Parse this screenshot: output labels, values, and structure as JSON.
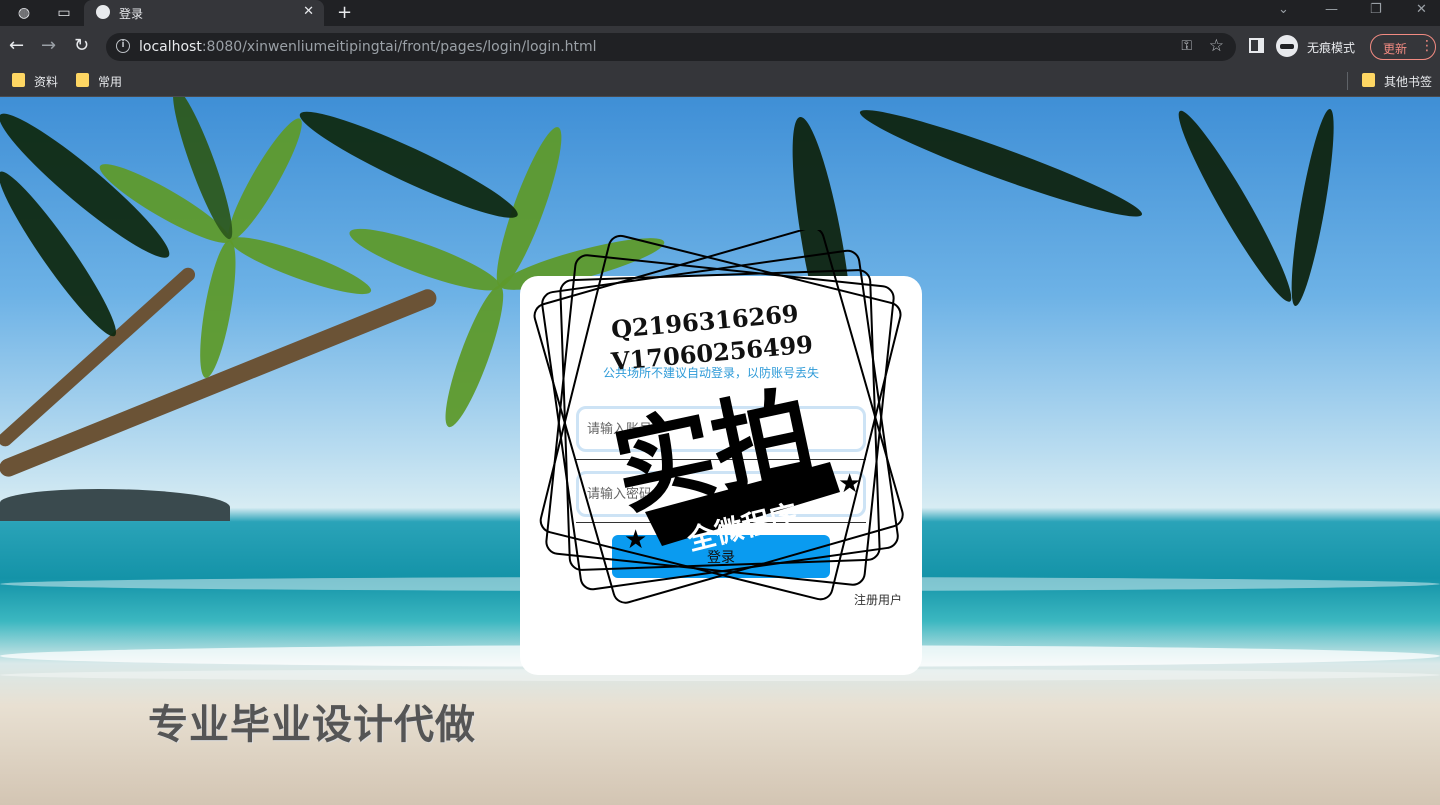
{
  "browser": {
    "tab_title": "登录",
    "url_host": "localhost",
    "url_rest": ":8080/xinwenliumeitipingtai/front/pages/login/login.html",
    "incognito_label": "无痕模式",
    "update_label": "更新",
    "bookmarks": [
      {
        "label": "资料"
      },
      {
        "label": "常用"
      }
    ],
    "other_bookmarks": "其他书签"
  },
  "login": {
    "notice": "公共场所不建议自动登录，以防账号丢失",
    "account_placeholder": "请输入账号",
    "password_placeholder": "请输入密码",
    "login_button": "登录",
    "register_link": "注册用户"
  },
  "overlay": {
    "contact_q": "Q2196316269",
    "contact_v": "V17060256499",
    "big_text": "实拍",
    "banner_text": "全微程序",
    "bottom_text": "专业毕业设计代做"
  }
}
